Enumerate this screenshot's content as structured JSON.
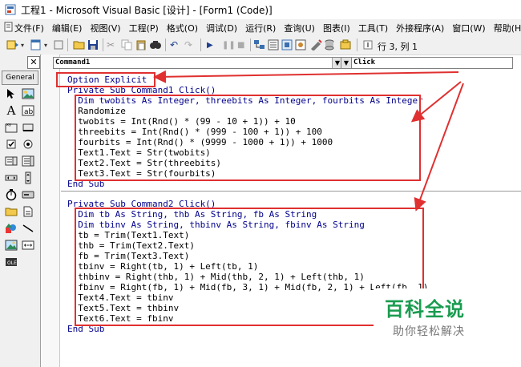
{
  "window": {
    "title": "工程1 - Microsoft Visual Basic [设计] - [Form1 (Code)]"
  },
  "menu": {
    "items": [
      "文件(F)",
      "编辑(E)",
      "视图(V)",
      "工程(P)",
      "格式(O)",
      "调试(D)",
      "运行(R)",
      "查询(U)",
      "图表(I)",
      "工具(T)",
      "外接程序(A)",
      "窗口(W)",
      "帮助(H)"
    ]
  },
  "toolbar": {
    "position_label": "行 3, 列 1"
  },
  "toolbox": {
    "close_glyph": "✕",
    "tab_label": "General"
  },
  "editor": {
    "object_value": "Command1",
    "procedure_value": "Click",
    "lines": {
      "l1": "Option Explicit",
      "l2": "Private Sub Command1_Click()",
      "l3": "  Dim twobits As Integer, threebits As Integer, fourbits As Integer",
      "l4": "  Randomize",
      "l5": "  twobits = Int(Rnd() * (99 - 10 + 1)) + 10",
      "l6": "  threebits = Int(Rnd() * (999 - 100 + 1)) + 100",
      "l7": "  fourbits = Int(Rnd() * (9999 - 1000 + 1)) + 1000",
      "l8": "  Text1.Text = Str(twobits)",
      "l9": "  Text2.Text = Str(threebits)",
      "l10": "  Text3.Text = Str(fourbits)",
      "l11": "End Sub",
      "l12": "Private Sub Command2_Click()",
      "l13": "  Dim tb As String, thb As String, fb As String",
      "l14": "  Dim tbinv As String, thbinv As String, fbinv As String",
      "l15": "  tb = Trim(Text1.Text)",
      "l16": "  thb = Trim(Text2.Text)",
      "l17": "  fb = Trim(Text3.Text)",
      "l18": "  tbinv = Right(tb, 1) + Left(tb, 1)",
      "l19": "  thbinv = Right(thb, 1) + Mid(thb, 2, 1) + Left(thb, 1)",
      "l20": "  fbinv = Right(fb, 1) + Mid(fb, 3, 1) + Mid(fb, 2, 1) + Left(fb, 1)",
      "l21": "  Text4.Text = tbinv",
      "l22": "  Text5.Text = thbinv",
      "l23": "  Text6.Text = fbinv",
      "l24": "End Sub"
    }
  },
  "watermark": {
    "logo": "百科全说",
    "tagline": "助你轻松解决"
  },
  "colors": {
    "annotation_red": "#e03030",
    "keyword_blue": "#00008b",
    "watermark_green": "#1a9c50"
  }
}
